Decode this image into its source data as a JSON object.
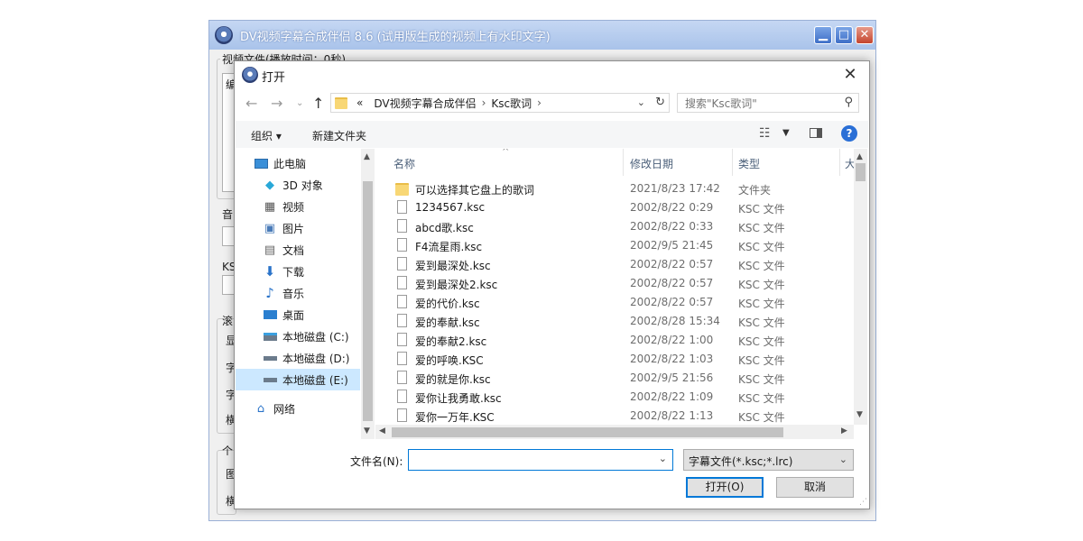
{
  "app": {
    "title": "DV视频字幕合成伴侣 8.6 (试用版生成的视频上有水印文字)",
    "group_video_label": "视频文件(播放时间：0秒)",
    "side_chars": [
      "编",
      "音",
      "KS",
      "滚",
      "显",
      "字",
      "字",
      "横",
      "个",
      "图",
      "横"
    ]
  },
  "dialog": {
    "title": "打开",
    "breadcrumb": [
      "«",
      "DV视频字幕合成伴侣",
      "Ksc歌词"
    ],
    "search_placeholder": "搜索\"Ksc歌词\"",
    "toolbar": {
      "organize": "组织 ▾",
      "new_folder": "新建文件夹"
    },
    "nav_items": [
      {
        "label": "此电脑",
        "icon": "pc-icon",
        "selected": false
      },
      {
        "label": "3D 对象",
        "icon": "cube-3d-icon",
        "selected": false
      },
      {
        "label": "视频",
        "icon": "video-icon",
        "selected": false
      },
      {
        "label": "图片",
        "icon": "picture-icon",
        "selected": false
      },
      {
        "label": "文档",
        "icon": "document-icon",
        "selected": false
      },
      {
        "label": "下载",
        "icon": "download-icon",
        "selected": false
      },
      {
        "label": "音乐",
        "icon": "music-icon",
        "selected": false
      },
      {
        "label": "桌面",
        "icon": "desktop-icon",
        "selected": false
      },
      {
        "label": "本地磁盘 (C:)",
        "icon": "drive-system-icon",
        "selected": false
      },
      {
        "label": "本地磁盘 (D:)",
        "icon": "drive-icon",
        "selected": false
      },
      {
        "label": "本地磁盘 (E:)",
        "icon": "drive-icon",
        "selected": true
      },
      {
        "label": "网络",
        "icon": "network-icon",
        "selected": false
      }
    ],
    "columns": {
      "name": "名称",
      "date": "修改日期",
      "type": "类型",
      "size": "大"
    },
    "files": [
      {
        "name": "可以选择其它盘上的歌词",
        "date": "2021/8/23 17:42",
        "type": "文件夹",
        "folder": true
      },
      {
        "name": "1234567.ksc",
        "date": "2002/8/22 0:29",
        "type": "KSC 文件",
        "folder": false
      },
      {
        "name": "abcd歌.ksc",
        "date": "2002/8/22 0:33",
        "type": "KSC 文件",
        "folder": false
      },
      {
        "name": "F4流星雨.ksc",
        "date": "2002/9/5 21:45",
        "type": "KSC 文件",
        "folder": false
      },
      {
        "name": "爱到最深处.ksc",
        "date": "2002/8/22 0:57",
        "type": "KSC 文件",
        "folder": false
      },
      {
        "name": "爱到最深处2.ksc",
        "date": "2002/8/22 0:57",
        "type": "KSC 文件",
        "folder": false
      },
      {
        "name": "爱的代价.ksc",
        "date": "2002/8/22 0:57",
        "type": "KSC 文件",
        "folder": false
      },
      {
        "name": "爱的奉献.ksc",
        "date": "2002/8/28 15:34",
        "type": "KSC 文件",
        "folder": false
      },
      {
        "name": "爱的奉献2.ksc",
        "date": "2002/8/22 1:00",
        "type": "KSC 文件",
        "folder": false
      },
      {
        "name": "爱的呼唤.KSC",
        "date": "2002/8/22 1:03",
        "type": "KSC 文件",
        "folder": false
      },
      {
        "name": "爱的就是你.ksc",
        "date": "2002/9/5 21:56",
        "type": "KSC 文件",
        "folder": false
      },
      {
        "name": "爱你让我勇敢.ksc",
        "date": "2002/8/22 1:09",
        "type": "KSC 文件",
        "folder": false
      },
      {
        "name": "爱你一万年.KSC",
        "date": "2002/8/22 1:13",
        "type": "KSC 文件",
        "folder": false
      }
    ],
    "filename_label": "文件名(N):",
    "filename_value": "",
    "filter_value": "字幕文件(*.ksc;*.lrc)",
    "open_button": "打开(O)",
    "cancel_button": "取消"
  }
}
